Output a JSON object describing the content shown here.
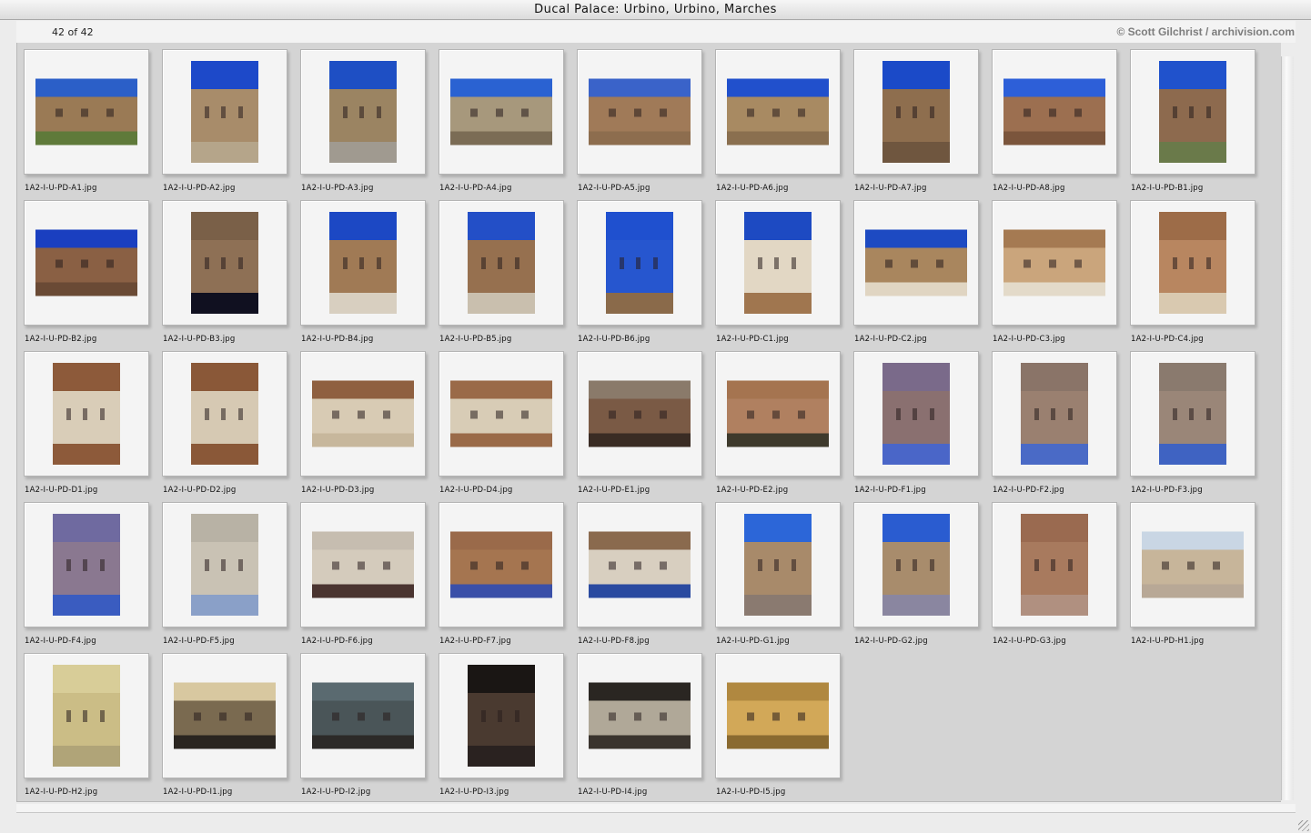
{
  "window": {
    "title": "Ducal Palace: Urbino, Urbino, Marches"
  },
  "header": {
    "count": "42 of 42",
    "credit": "© Scott Gilchrist / archivision.com"
  },
  "icons": {
    "resize": "resize-grip-icon"
  },
  "gallery": {
    "items": [
      {
        "file": "1A2-I-U-PD-A1.jpg",
        "orient": "land",
        "sky": "#2b5fc8",
        "body": "#9a7a55",
        "lower": "#5f7a3a"
      },
      {
        "file": "1A2-I-U-PD-A2.jpg",
        "orient": "port",
        "sky": "#1d49c9",
        "body": "#a88c6a",
        "lower": "#b5a58a"
      },
      {
        "file": "1A2-I-U-PD-A3.jpg",
        "orient": "port",
        "sky": "#1e4fc4",
        "body": "#9b8462",
        "lower": "#a09a90"
      },
      {
        "file": "1A2-I-U-PD-A4.jpg",
        "orient": "land",
        "sky": "#2a62d2",
        "body": "#a7987c",
        "lower": "#7b6c55"
      },
      {
        "file": "1A2-I-U-PD-A5.jpg",
        "orient": "land",
        "sky": "#3a63c9",
        "body": "#a07a58",
        "lower": "#8d6d4e"
      },
      {
        "file": "1A2-I-U-PD-A6.jpg",
        "orient": "land",
        "sky": "#2150cc",
        "body": "#a88a62",
        "lower": "#8a6f4f"
      },
      {
        "file": "1A2-I-U-PD-A7.jpg",
        "orient": "port",
        "sky": "#1b4ac8",
        "body": "#8e6e4e",
        "lower": "#6f563f"
      },
      {
        "file": "1A2-I-U-PD-A8.jpg",
        "orient": "land",
        "sky": "#2d5fd8",
        "body": "#9c6f50",
        "lower": "#7b553c"
      },
      {
        "file": "1A2-I-U-PD-B1.jpg",
        "orient": "port",
        "sky": "#2052cc",
        "body": "#8d6a4e",
        "lower": "#6a7a4a"
      },
      {
        "file": "1A2-I-U-PD-B2.jpg",
        "orient": "land",
        "sky": "#1a3fc0",
        "body": "#8a6044",
        "lower": "#6a4a35"
      },
      {
        "file": "1A2-I-U-PD-B3.jpg",
        "orient": "port",
        "sky": "#7a6048",
        "body": "#8e7055",
        "lower": "#101020"
      },
      {
        "file": "1A2-I-U-PD-B4.jpg",
        "orient": "port",
        "sky": "#1c48c4",
        "body": "#a07a55",
        "lower": "#d8cfc0"
      },
      {
        "file": "1A2-I-U-PD-B5.jpg",
        "orient": "port",
        "sky": "#234fc7",
        "body": "#96704f",
        "lower": "#c9bfae"
      },
      {
        "file": "1A2-I-U-PD-B6.jpg",
        "orient": "port",
        "sky": "#1f50cf",
        "body": "#2656cf",
        "lower": "#8a6a4a"
      },
      {
        "file": "1A2-I-U-PD-C1.jpg",
        "orient": "port",
        "sky": "#1d4ac2",
        "body": "#e2d7c4",
        "lower": "#a0764f"
      },
      {
        "file": "1A2-I-U-PD-C2.jpg",
        "orient": "land",
        "sky": "#1d4ac2",
        "body": "#a9865e",
        "lower": "#e0d5c2"
      },
      {
        "file": "1A2-I-U-PD-C3.jpg",
        "orient": "land",
        "sky": "#a57a52",
        "body": "#caa57c",
        "lower": "#e3dac9"
      },
      {
        "file": "1A2-I-U-PD-C4.jpg",
        "orient": "port",
        "sky": "#9d6c48",
        "body": "#b88660",
        "lower": "#d9c9b0"
      },
      {
        "file": "1A2-I-U-PD-D1.jpg",
        "orient": "port",
        "sky": "#8d5a3a",
        "body": "#d9cdb8",
        "lower": "#8d5a3a"
      },
      {
        "file": "1A2-I-U-PD-D2.jpg",
        "orient": "port",
        "sky": "#8a5838",
        "body": "#d6c9b3",
        "lower": "#8a5838"
      },
      {
        "file": "1A2-I-U-PD-D3.jpg",
        "orient": "land",
        "sky": "#8f6040",
        "body": "#d8cbb4",
        "lower": "#c7b79c"
      },
      {
        "file": "1A2-I-U-PD-D4.jpg",
        "orient": "land",
        "sky": "#9a6a48",
        "body": "#d8ccb6",
        "lower": "#9a6a48"
      },
      {
        "file": "1A2-I-U-PD-E1.jpg",
        "orient": "land",
        "sky": "#8a7a6a",
        "body": "#7a5a45",
        "lower": "#3a2c24"
      },
      {
        "file": "1A2-I-U-PD-E2.jpg",
        "orient": "land",
        "sky": "#a57450",
        "body": "#b08060",
        "lower": "#3e3a2c"
      },
      {
        "file": "1A2-I-U-PD-F1.jpg",
        "orient": "port",
        "sky": "#7a6a8a",
        "body": "#8a7070",
        "lower": "#4a66c8"
      },
      {
        "file": "1A2-I-U-PD-F2.jpg",
        "orient": "port",
        "sky": "#8a7468",
        "body": "#9a8070",
        "lower": "#4a6ac6"
      },
      {
        "file": "1A2-I-U-PD-F3.jpg",
        "orient": "port",
        "sky": "#8a7a6e",
        "body": "#9a8678",
        "lower": "#3f63c2"
      },
      {
        "file": "1A2-I-U-PD-F4.jpg",
        "orient": "port",
        "sky": "#6f6aa0",
        "body": "#8a7890",
        "lower": "#3a5cc0"
      },
      {
        "file": "1A2-I-U-PD-F5.jpg",
        "orient": "port",
        "sky": "#b8b2a5",
        "body": "#c9c2b4",
        "lower": "#8aa0c8"
      },
      {
        "file": "1A2-I-U-PD-F6.jpg",
        "orient": "land",
        "sky": "#c6bdb0",
        "body": "#d4cbbc",
        "lower": "#4a3430"
      },
      {
        "file": "1A2-I-U-PD-F7.jpg",
        "orient": "land",
        "sky": "#9a6a4a",
        "body": "#a57550",
        "lower": "#3a4fa8"
      },
      {
        "file": "1A2-I-U-PD-F8.jpg",
        "orient": "land",
        "sky": "#8a6a4e",
        "body": "#d8cfc0",
        "lower": "#2a4aa0"
      },
      {
        "file": "1A2-I-U-PD-G1.jpg",
        "orient": "port",
        "sky": "#2c66d8",
        "body": "#a88a6a",
        "lower": "#8a7a70"
      },
      {
        "file": "1A2-I-U-PD-G2.jpg",
        "orient": "port",
        "sky": "#2a5cd0",
        "body": "#a88c6c",
        "lower": "#8a86a0"
      },
      {
        "file": "1A2-I-U-PD-G3.jpg",
        "orient": "port",
        "sky": "#9a6a50",
        "body": "#a87a5e",
        "lower": "#b09080"
      },
      {
        "file": "1A2-I-U-PD-H1.jpg",
        "orient": "land",
        "sky": "#c9d6e4",
        "body": "#c7b59a",
        "lower": "#b8a896"
      },
      {
        "file": "1A2-I-U-PD-H2.jpg",
        "orient": "port",
        "sky": "#d8cd98",
        "body": "#cbbd86",
        "lower": "#b0a478"
      },
      {
        "file": "1A2-I-U-PD-I1.jpg",
        "orient": "land",
        "sky": "#d8c8a0",
        "body": "#7a6a50",
        "lower": "#2a2520"
      },
      {
        "file": "1A2-I-U-PD-I2.jpg",
        "orient": "land",
        "sky": "#5a6a70",
        "body": "#4a5558",
        "lower": "#2c2a28"
      },
      {
        "file": "1A2-I-U-PD-I3.jpg",
        "orient": "port",
        "sky": "#1a1614",
        "body": "#4a3a30",
        "lower": "#2a2220"
      },
      {
        "file": "1A2-I-U-PD-I4.jpg",
        "orient": "land",
        "sky": "#2a2622",
        "body": "#b0a898",
        "lower": "#3a342e"
      },
      {
        "file": "1A2-I-U-PD-I5.jpg",
        "orient": "land",
        "sky": "#b08840",
        "body": "#d2a858",
        "lower": "#8a6a30"
      }
    ]
  }
}
